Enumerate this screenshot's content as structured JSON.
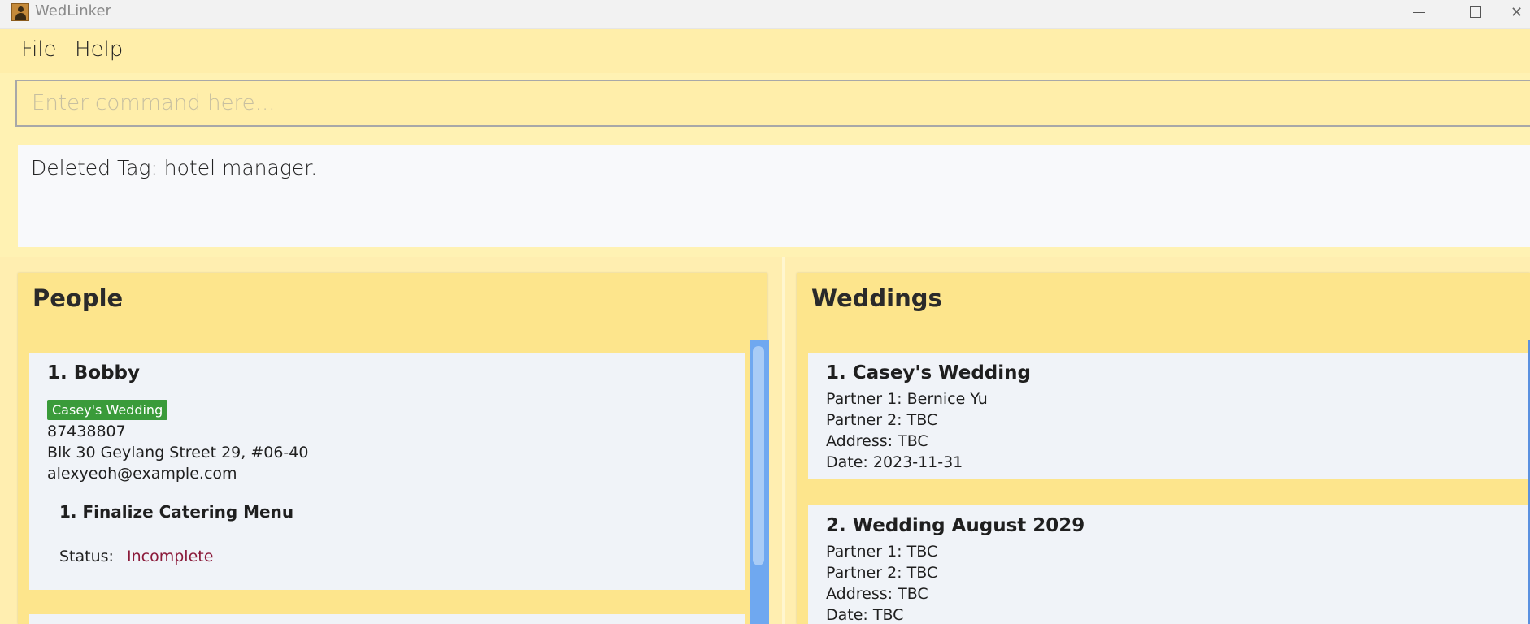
{
  "window": {
    "title": "WedLinker",
    "close_glyph": "✕"
  },
  "menu": {
    "file": "File",
    "help": "Help"
  },
  "command": {
    "placeholder": "Enter command here...",
    "value": ""
  },
  "result": {
    "text": "Deleted Tag: hotel manager."
  },
  "people": {
    "title": "People",
    "items": [
      {
        "index_name": "1.  Bobby",
        "tag": "Casey's Wedding",
        "phone": "87438807",
        "address": "Blk 30 Geylang Street 29, #06-40",
        "email": "alexyeoh@example.com",
        "task": {
          "title": "1.  Finalize Catering Menu",
          "status_label": "Status:",
          "status_value": "Incomplete"
        }
      }
    ]
  },
  "weddings": {
    "title": "Weddings",
    "items": [
      {
        "title": "1.  Casey's Wedding",
        "partner1": "Partner 1: Bernice Yu",
        "partner2": "Partner 2: TBC",
        "address": "Address: TBC",
        "date": "Date: 2023-11-31"
      },
      {
        "title": "2.  Wedding August 2029",
        "partner1": "Partner 1: TBC",
        "partner2": "Partner 2: TBC",
        "address": "Address: TBC",
        "date": "Date: TBC"
      }
    ]
  },
  "colors": {
    "background": "#fff2b3",
    "panel": "#fde58c",
    "card": "#f0f3f8",
    "tag": "#3a9b3a",
    "status_incomplete": "#8b1a3a",
    "scrollbar": "#6fa8f0"
  }
}
